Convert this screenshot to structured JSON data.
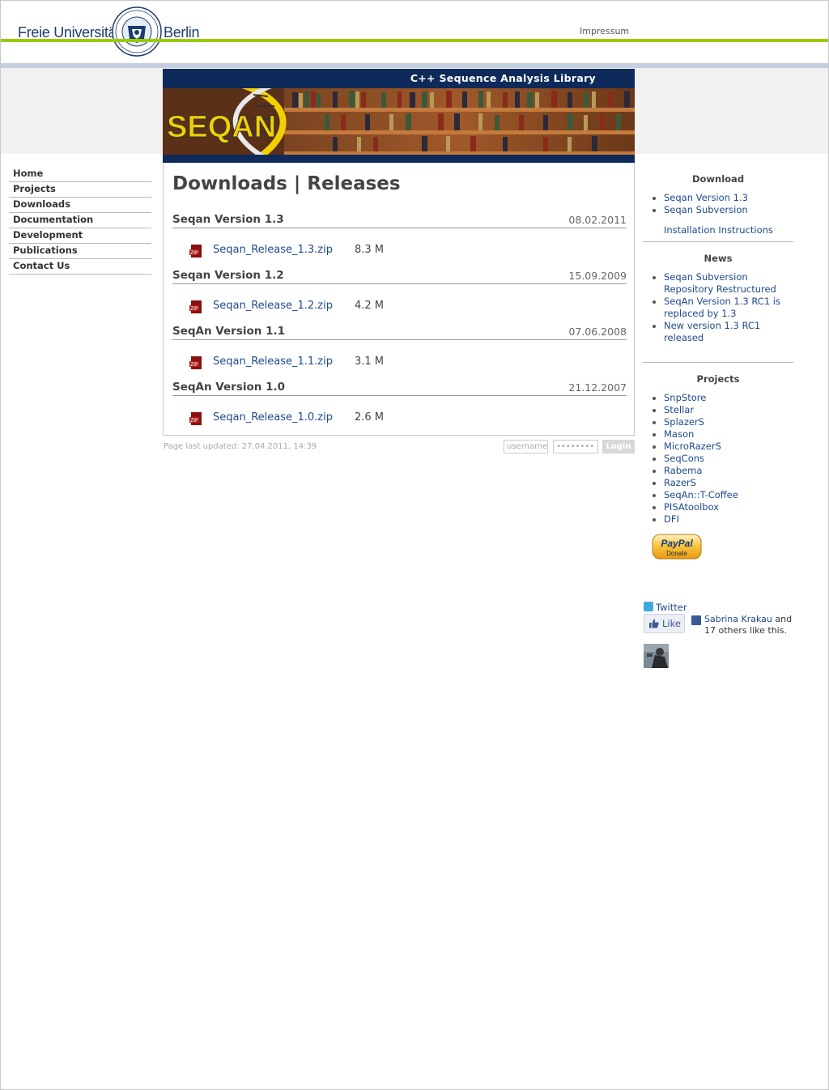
{
  "header": {
    "logo_left": "Freie Universität",
    "logo_right": "Berlin",
    "impressum": "Impressum"
  },
  "banner": {
    "title": "C++ Sequence Analysis Library",
    "logo_text": "SEQAN"
  },
  "nav": {
    "items": [
      {
        "label": "Home"
      },
      {
        "label": "Projects"
      },
      {
        "label": "Downloads"
      },
      {
        "label": "Documentation"
      },
      {
        "label": "Development"
      },
      {
        "label": "Publications"
      },
      {
        "label": "Contact Us"
      }
    ]
  },
  "main": {
    "title": "Downloads | Releases",
    "releases": [
      {
        "name": "Seqan Version 1.3",
        "date": "08.02.2011",
        "file": "Seqan_Release_1.3.zip",
        "size": "8.3 M"
      },
      {
        "name": "Seqan Version 1.2",
        "date": "15.09.2009",
        "file": "Seqan_Release_1.2.zip",
        "size": "4.2 M"
      },
      {
        "name": "SeqAn Version 1.1",
        "date": "07.06.2008",
        "file": "Seqan_Release_1.1.zip",
        "size": "3.1 M"
      },
      {
        "name": "SeqAn Version 1.0",
        "date": "21.12.2007",
        "file": "Seqan_Release_1.0.zip",
        "size": "2.6 M"
      }
    ],
    "zip_icon_label": "ZIP"
  },
  "footer": {
    "updated": "Page last updated: 27.04.2011, 14:39",
    "username_placeholder": "username",
    "password_value": "••••••••",
    "login_label": "Login"
  },
  "sidebar": {
    "download_heading": "Download",
    "download_items": [
      "Seqan Version 1.3",
      "Seqan Subversion"
    ],
    "installation": "Installation Instructions",
    "news_heading": "News",
    "news_items": [
      "Seqan Subversion Repository Restructured",
      "SeqAn Version 1.3 RC1 is replaced by 1.3",
      "New version 1.3 RC1 released"
    ],
    "projects_heading": "Projects",
    "project_items": [
      "SnpStore",
      "Stellar",
      "SplazerS",
      "Mason",
      "MicroRazerS",
      "SeqCons",
      "Rabema",
      "RazerS",
      "SeqAn::T-Coffee",
      "PISAtoolbox",
      "DFI"
    ],
    "paypal_brand": "PayPal",
    "paypal_label": "Donate",
    "twitter": "Twitter",
    "like": "Like",
    "fb_name": "Sabrina Krakau",
    "fb_and": "and",
    "fb_others": "17 others like this."
  },
  "colors": {
    "green_line": "#99cc00",
    "banner_blue": "#0e2a5a",
    "link_blue": "#1d4a8c"
  }
}
